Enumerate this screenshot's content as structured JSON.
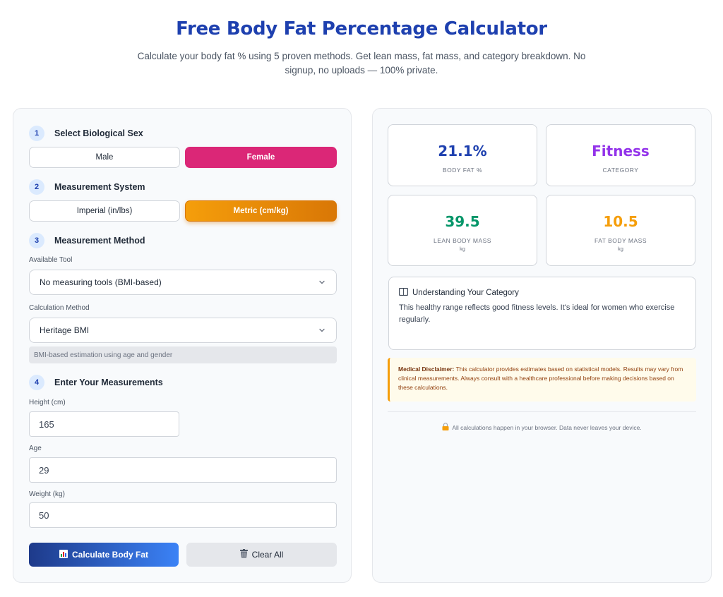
{
  "header": {
    "title": "Free Body Fat Percentage Calculator",
    "subtitle": "Calculate your body fat % using 5 proven methods. Get lean mass, fat mass, and category breakdown. No signup, no uploads — 100% private."
  },
  "form": {
    "step1": {
      "num": "1",
      "label": "Select Biological Sex",
      "male": "Male",
      "female": "Female",
      "selected": "Female"
    },
    "step2": {
      "num": "2",
      "label": "Measurement System",
      "imperial": "Imperial (in/lbs)",
      "metric": "Metric (cm/kg)",
      "selected": "Metric (cm/kg)"
    },
    "step3": {
      "num": "3",
      "label": "Measurement Method",
      "tool_label": "Available Tool",
      "tool_value": "No measuring tools (BMI-based)",
      "method_label": "Calculation Method",
      "method_value": "Heritage BMI",
      "hint": "BMI-based estimation using age and gender"
    },
    "step4": {
      "num": "4",
      "label": "Enter Your Measurements",
      "height_label": "Height (cm)",
      "height_value": "165",
      "age_label": "Age",
      "age_value": "29",
      "weight_label": "Weight (kg)",
      "weight_value": "50"
    },
    "calculate_label": "Calculate Body Fat",
    "clear_label": "Clear All"
  },
  "results": {
    "body_fat": {
      "value": "21.1%",
      "label": "BODY FAT %"
    },
    "category": {
      "value": "Fitness",
      "label": "CATEGORY"
    },
    "lean_mass": {
      "value": "39.5",
      "label": "LEAN BODY MASS",
      "unit": "kg"
    },
    "fat_mass": {
      "value": "10.5",
      "label": "FAT BODY MASS",
      "unit": "kg"
    },
    "understanding": {
      "title": "Understanding Your Category",
      "text": "This healthy range reflects good fitness levels. It's ideal for women who exercise regularly."
    },
    "disclaimer": {
      "label": "Medical Disclaimer:",
      "text": "This calculator provides estimates based on statistical models. Results may vary from clinical measurements. Always consult with a healthcare professional before making decisions based on these calculations."
    },
    "privacy": "All calculations happen in your browser. Data never leaves your device."
  },
  "colors": {
    "brand": "#1e40af",
    "female": "#db2777",
    "metric": "#f59e0b",
    "body_fat": "#1e40af",
    "category": "#9333ea",
    "lean": "#059669",
    "fat": "#f59e0b"
  },
  "icons": {
    "chart": "chart-icon",
    "trash": "trash-icon",
    "book": "book-icon",
    "lock": "lock-icon",
    "chevron": "chevron-down-icon"
  }
}
